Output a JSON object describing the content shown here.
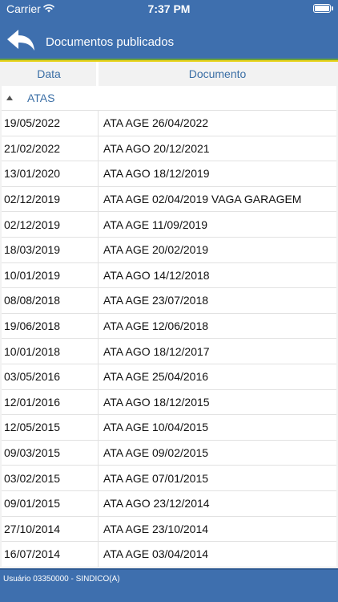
{
  "status_bar": {
    "carrier": "Carrier",
    "time": "7:37 PM"
  },
  "header": {
    "title": "Documentos publicados"
  },
  "table": {
    "columns": [
      "Data",
      "Documento"
    ],
    "group": {
      "label": "ATAS"
    },
    "rows": [
      {
        "date": "19/05/2022",
        "document": "ATA AGE 26/04/2022"
      },
      {
        "date": "21/02/2022",
        "document": "ATA AGO 20/12/2021"
      },
      {
        "date": "13/01/2020",
        "document": "ATA AGO 18/12/2019"
      },
      {
        "date": "02/12/2019",
        "document": "ATA AGE 02/04/2019 VAGA GARAGEM"
      },
      {
        "date": "02/12/2019",
        "document": "ATA AGE 11/09/2019"
      },
      {
        "date": "18/03/2019",
        "document": "ATA AGE 20/02/2019"
      },
      {
        "date": "10/01/2019",
        "document": "ATA AGO 14/12/2018"
      },
      {
        "date": "08/08/2018",
        "document": "ATA AGE 23/07/2018"
      },
      {
        "date": "19/06/2018",
        "document": "ATA AGE 12/06/2018"
      },
      {
        "date": "10/01/2018",
        "document": "ATA AGO 18/12/2017"
      },
      {
        "date": "03/05/2016",
        "document": "ATA AGE 25/04/2016"
      },
      {
        "date": "12/01/2016",
        "document": "ATA AGO 18/12/2015"
      },
      {
        "date": "12/05/2015",
        "document": "ATA AGE 10/04/2015"
      },
      {
        "date": "09/03/2015",
        "document": "ATA AGE 09/02/2015"
      },
      {
        "date": "03/02/2015",
        "document": "ATA AGE 07/01/2015"
      },
      {
        "date": "09/01/2015",
        "document": "ATA AGO 23/12/2014"
      },
      {
        "date": "27/10/2014",
        "document": "ATA AGE 23/10/2014"
      },
      {
        "date": "16/07/2014",
        "document": "ATA AGE 03/04/2014"
      }
    ]
  },
  "footer": {
    "user_text": "Usuário   03350000 - SINDICO(A)"
  },
  "colors": {
    "header_bg": "#3e6fae",
    "link_blue": "#3a6ea5",
    "stripe_green": "#6aa23a",
    "stripe_yellow": "#e8d21a"
  },
  "icons": {
    "back": "back-arrow-icon",
    "wifi": "wifi-icon",
    "battery": "battery-icon",
    "collapse": "caret-up-icon"
  }
}
